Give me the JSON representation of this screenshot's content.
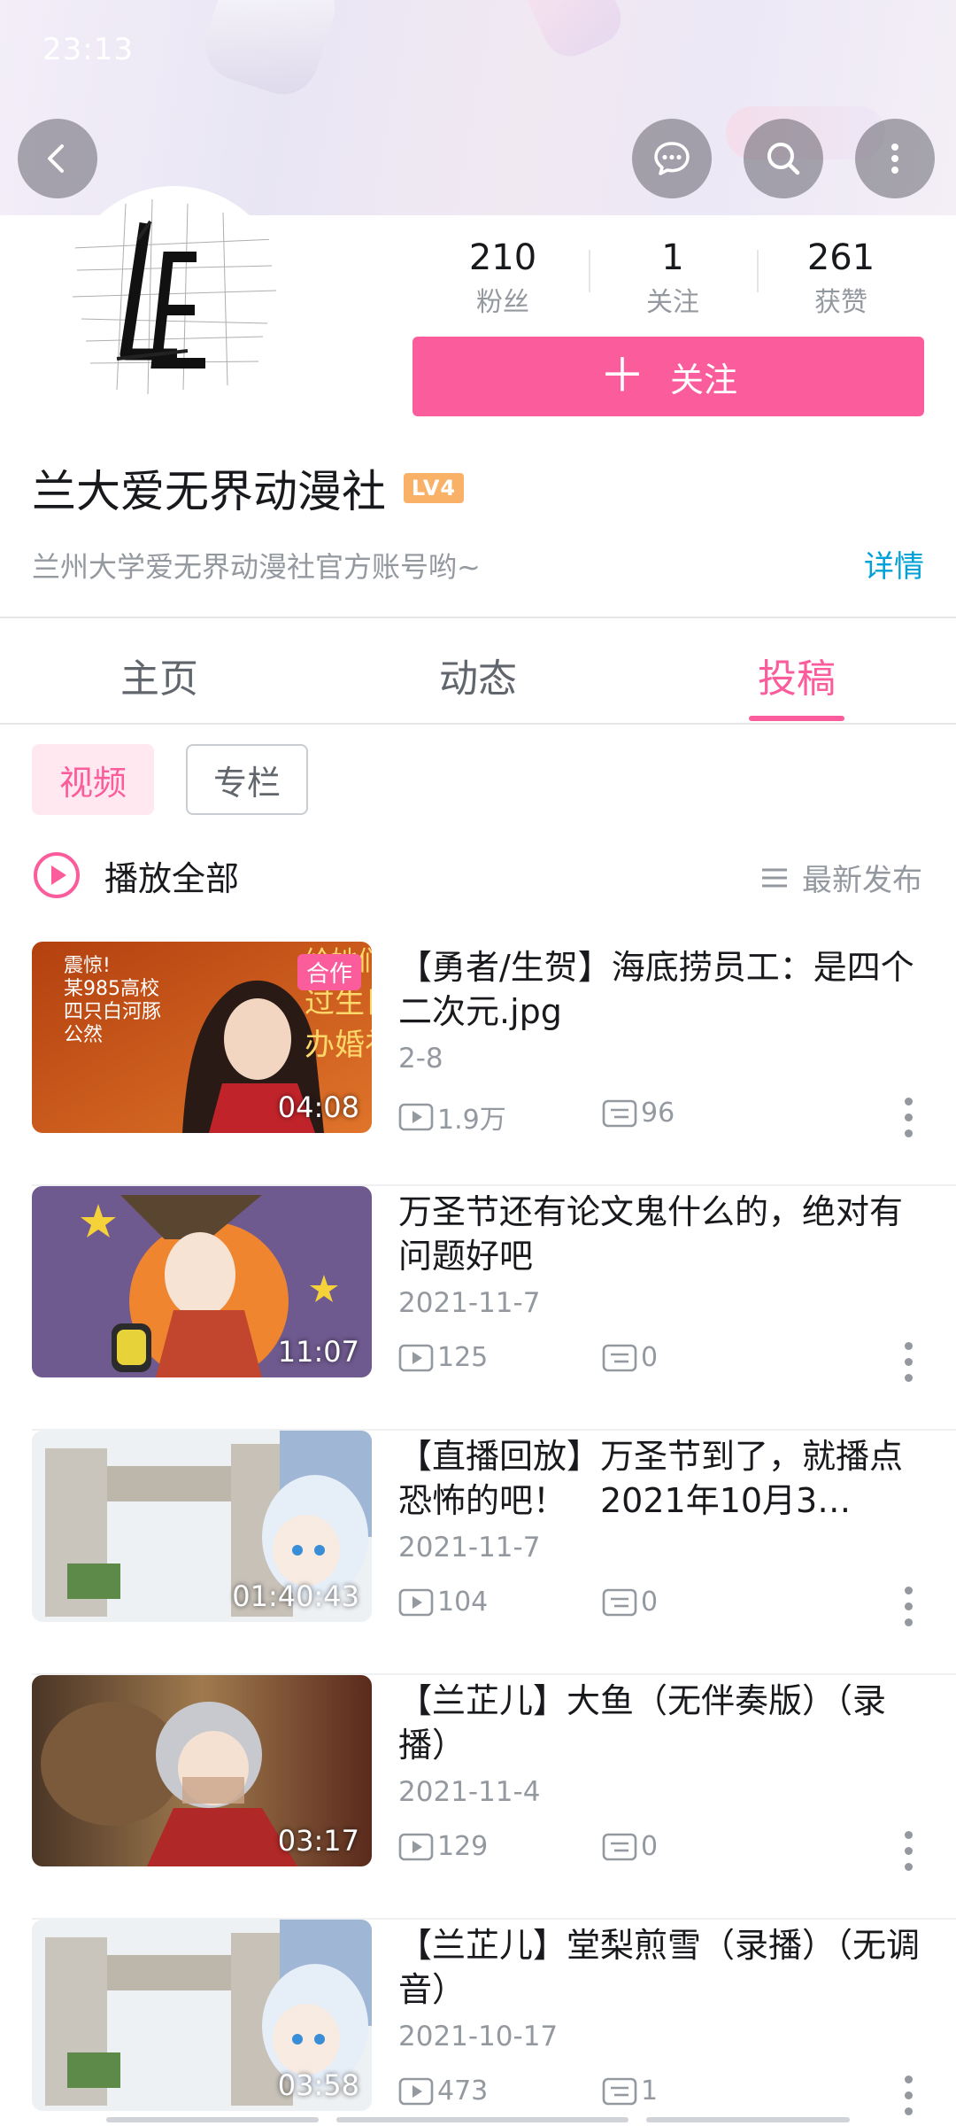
{
  "status_bar": {
    "time": "23:13"
  },
  "profile": {
    "name": "兰大爱无界动漫社",
    "level": "LV4",
    "signature": "兰州大学爱无界动漫社官方账号哟~",
    "detail_label": "详情",
    "follow_label": "关注",
    "stats": [
      {
        "value": "210",
        "label": "粉丝"
      },
      {
        "value": "1",
        "label": "关注"
      },
      {
        "value": "261",
        "label": "获赞"
      }
    ]
  },
  "tabs": [
    {
      "label": "主页"
    },
    {
      "label": "动态"
    },
    {
      "label": "投稿",
      "active": true
    }
  ],
  "subtabs": [
    {
      "label": "视频",
      "active": true
    },
    {
      "label": "专栏"
    }
  ],
  "list_header": {
    "play_all": "播放全部",
    "sort": "最新发布"
  },
  "thumb_texts": {
    "v1_left": [
      "震惊!",
      "某985高校",
      "四只白河豚",
      "公然"
    ],
    "v1_right": [
      "给她们",
      "过生日",
      "办婚礼"
    ]
  },
  "videos": [
    {
      "title": "【勇者/生贺】海底捞员工：是四个二次元.jpg",
      "date": "2-8",
      "views": "1.9万",
      "comments": "96",
      "duration": "04:08",
      "badge": "合作"
    },
    {
      "title": "万圣节还有论文鬼什么的，绝对有问题好吧",
      "date": "2021-11-7",
      "views": "125",
      "comments": "0",
      "duration": "11:07"
    },
    {
      "title": "【直播回放】万圣节到了，就播点恐怖的吧！　2021年10月3…",
      "date": "2021-11-7",
      "views": "104",
      "comments": "0",
      "duration": "01:40:43"
    },
    {
      "title": "【兰芷儿】大鱼（无伴奏版）（录播）",
      "date": "2021-11-4",
      "views": "129",
      "comments": "0",
      "duration": "03:17"
    },
    {
      "title": "【兰芷儿】堂梨煎雪（录播）（无调音）",
      "date": "2021-10-17",
      "views": "473",
      "comments": "1",
      "duration": "03:58"
    }
  ],
  "colors": {
    "accent": "#fb5d9c",
    "link": "#00a1d6",
    "muted": "#9499a0"
  }
}
